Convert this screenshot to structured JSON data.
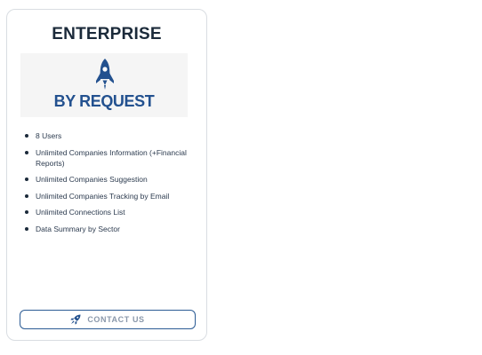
{
  "plan": {
    "title": "ENTERPRISE",
    "price_label": "BY REQUEST",
    "icon": "rocket-icon",
    "accent_color": "#23518f",
    "features": [
      "8 Users",
      "Unlimited Companies Information (+Financial Reports)",
      "Unlimited Companies Suggestion",
      "Unlimited Companies Tracking by Email",
      "Unlimited Connections List",
      "Data Summary by Sector"
    ],
    "cta": {
      "label": "CONTACT US",
      "icon": "rocket-icon"
    }
  }
}
